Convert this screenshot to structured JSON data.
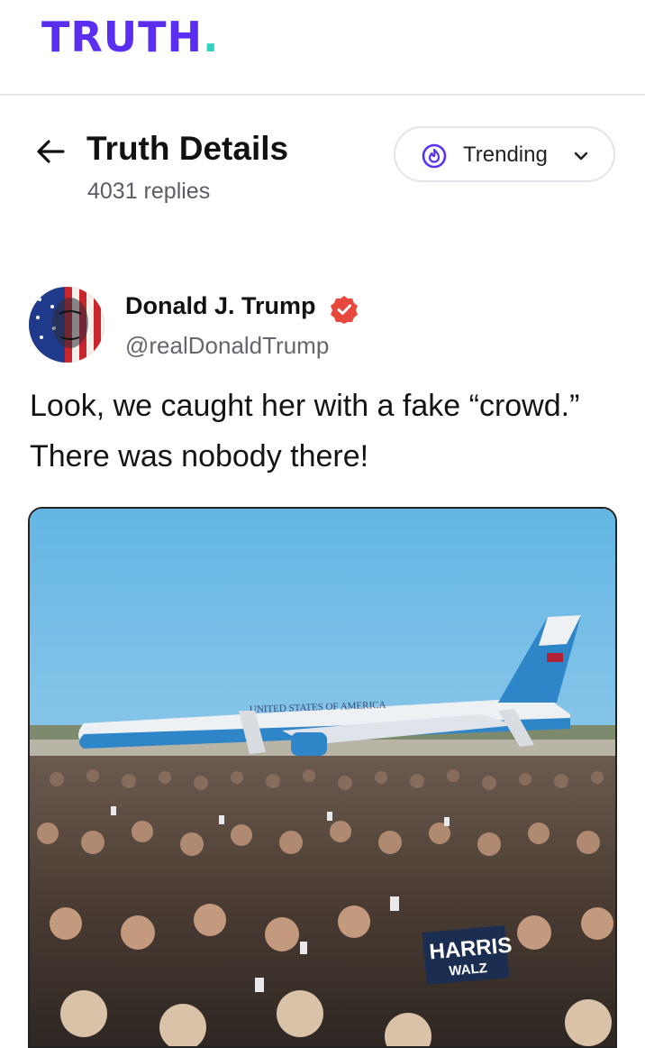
{
  "brand": {
    "logo_text": "TRUTH",
    "logo_dot": ".",
    "color": "#5a2ff2",
    "dot_color": "#2fd1c1"
  },
  "header": {
    "back_icon": "arrow-left-icon",
    "title": "Truth Details",
    "replies": "4031 replies",
    "sort": {
      "label": "Trending",
      "icon": "flame-icon",
      "dropdown_icon": "chevron-down-icon",
      "accent": "#5a2ff2"
    }
  },
  "post": {
    "author_name": "Donald J. Trump",
    "verified_icon": "verified-badge-icon",
    "verified_color": "#e8473d",
    "handle": "@realDonaldTrump",
    "text": "Look, we caught her with a fake “crowd.” There was nobody there!",
    "media": {
      "description_icon": "photo",
      "plane_lettering": "UNITED STATES OF AMERICA",
      "sign_line1": "HARRIS",
      "sign_line2": "WALZ"
    }
  }
}
